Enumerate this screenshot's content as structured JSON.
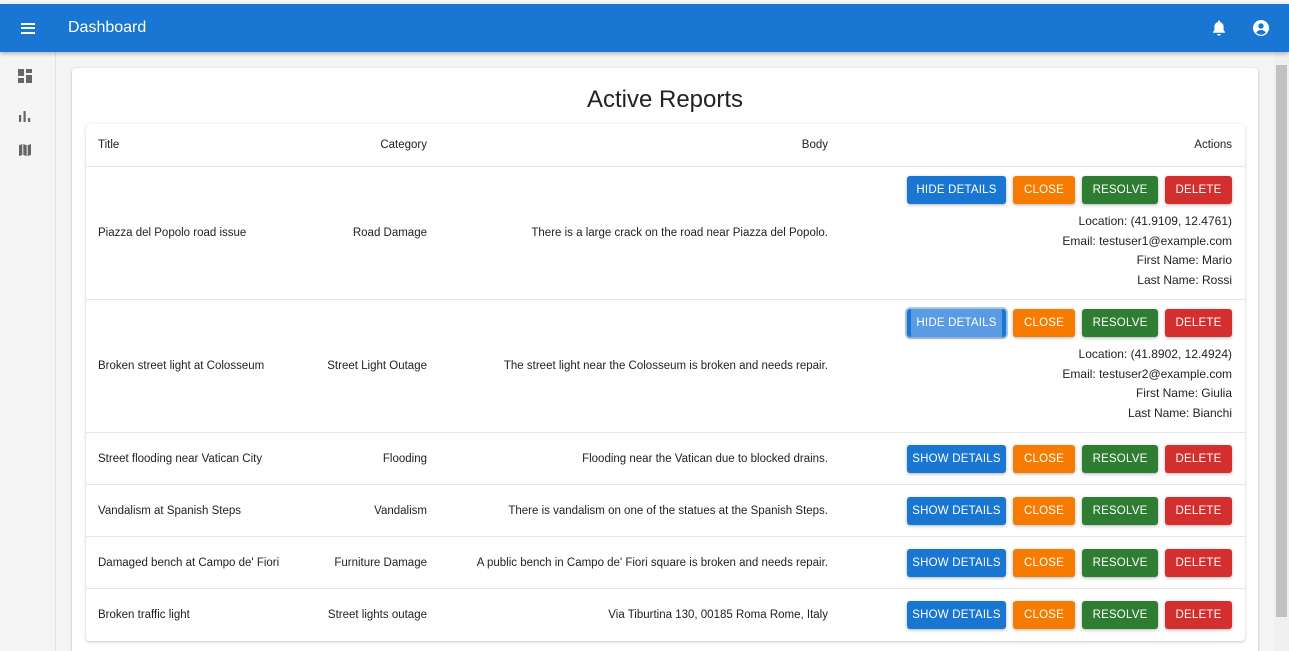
{
  "appbar": {
    "title": "Dashboard"
  },
  "icons": {
    "menu": "menu-icon",
    "notifications": "bell-icon",
    "account": "account-circle-icon"
  },
  "sidebar": {
    "items": [
      {
        "name": "dashboard",
        "icon": "dashboard-icon"
      },
      {
        "name": "charts",
        "icon": "bar-chart-icon"
      },
      {
        "name": "map",
        "icon": "map-icon"
      }
    ]
  },
  "page": {
    "title": "Active Reports"
  },
  "table": {
    "headers": {
      "title": "Title",
      "category": "Category",
      "body": "Body",
      "actions": "Actions"
    },
    "buttons": {
      "close": "Close",
      "resolve": "Resolve",
      "delete": "Delete"
    },
    "rows": [
      {
        "title": "Piazza del Popolo road issue",
        "category": "Road Damage",
        "body": "There is a large crack on the road near Piazza del Popolo.",
        "details_button": "Hide Details",
        "details": {
          "location": "Location: (41.9109, 12.4761)",
          "email": "Email: testuser1@example.com",
          "first_name": "First Name: Mario",
          "last_name": "Last Name: Rossi"
        }
      },
      {
        "title": "Broken street light at Colosseum",
        "category": "Street Light Outage",
        "body": "The street light near the Colosseum is broken and needs repair.",
        "details_button": "Hide Details",
        "details": {
          "location": "Location: (41.8902, 12.4924)",
          "email": "Email: testuser2@example.com",
          "first_name": "First Name: Giulia",
          "last_name": "Last Name: Bianchi"
        }
      },
      {
        "title": "Street flooding near Vatican City",
        "category": "Flooding",
        "body": "Flooding near the Vatican due to blocked drains.",
        "details_button": "Show Details"
      },
      {
        "title": "Vandalism at Spanish Steps",
        "category": "Vandalism",
        "body": "There is vandalism on one of the statues at the Spanish Steps.",
        "details_button": "Show Details"
      },
      {
        "title": "Damaged bench at Campo de' Fiori",
        "category": "Furniture Damage",
        "body": "A public bench in Campo de' Fiori square is broken and needs repair.",
        "details_button": "Show Details"
      },
      {
        "title": "Broken traffic light",
        "category": "Street lights outage",
        "body": "Via Tiburtina 130, 00185 Roma Rome, Italy",
        "details_button": "Show Details"
      }
    ]
  },
  "colors": {
    "primary": "#1976d2",
    "close": "#f57c00",
    "resolve": "#2e7d32",
    "delete": "#d32f2f"
  }
}
